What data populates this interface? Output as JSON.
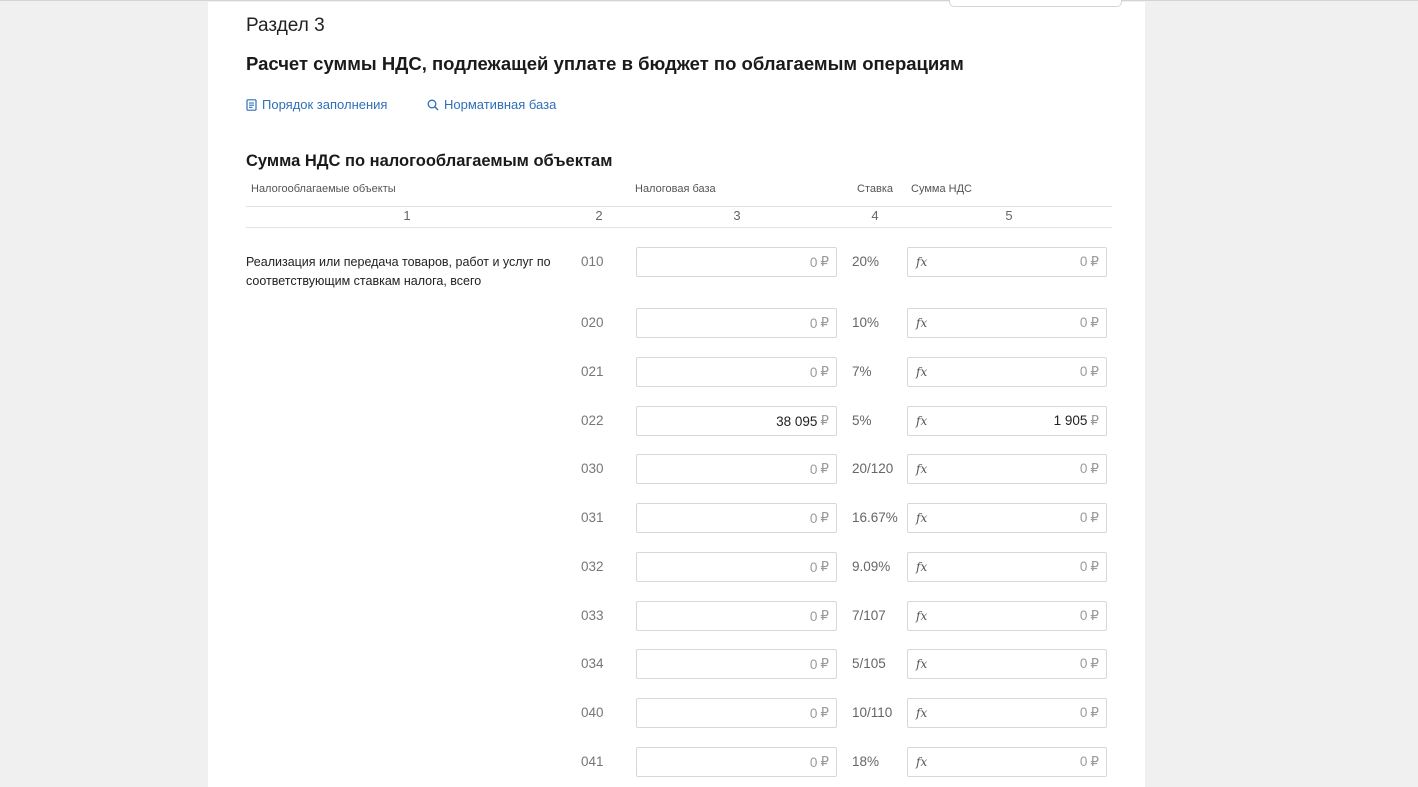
{
  "section": {
    "label": "Раздел 3",
    "title": "Расчет суммы НДС, подлежащей уплате в бюджет по облагаемым операциям"
  },
  "links": {
    "fill_order": "Порядок заполнения",
    "regulatory_base": "Нормативная база"
  },
  "table": {
    "subtitle": "Сумма НДС по налогооблагаемым объектам",
    "headers": {
      "objects": "Налогооблагаемые объекты",
      "tax_base": "Налоговая база",
      "rate": "Ставка",
      "vat_sum": "Сумма НДС"
    },
    "col_numbers": [
      "1",
      "2",
      "3",
      "4",
      "5"
    ],
    "row_text": "Реализация или передача товаров, работ и услуг по соответствующим ставкам налога, всего",
    "currency": "₽",
    "fx_label": "fx",
    "rows": [
      {
        "code": "010",
        "base": "0",
        "rate": "20%",
        "vat": "0"
      },
      {
        "code": "020",
        "base": "0",
        "rate": "10%",
        "vat": "0"
      },
      {
        "code": "021",
        "base": "0",
        "rate": "7%",
        "vat": "0"
      },
      {
        "code": "022",
        "base": "38 095",
        "rate": "5%",
        "vat": "1 905"
      },
      {
        "code": "030",
        "base": "0",
        "rate": "20/120",
        "vat": "0"
      },
      {
        "code": "031",
        "base": "0",
        "rate": "16.67%",
        "vat": "0"
      },
      {
        "code": "032",
        "base": "0",
        "rate": "9.09%",
        "vat": "0"
      },
      {
        "code": "033",
        "base": "0",
        "rate": "7/107",
        "vat": "0"
      },
      {
        "code": "034",
        "base": "0",
        "rate": "5/105",
        "vat": "0"
      },
      {
        "code": "040",
        "base": "0",
        "rate": "10/110",
        "vat": "0"
      },
      {
        "code": "041",
        "base": "0",
        "rate": "18%",
        "vat": "0"
      }
    ]
  }
}
